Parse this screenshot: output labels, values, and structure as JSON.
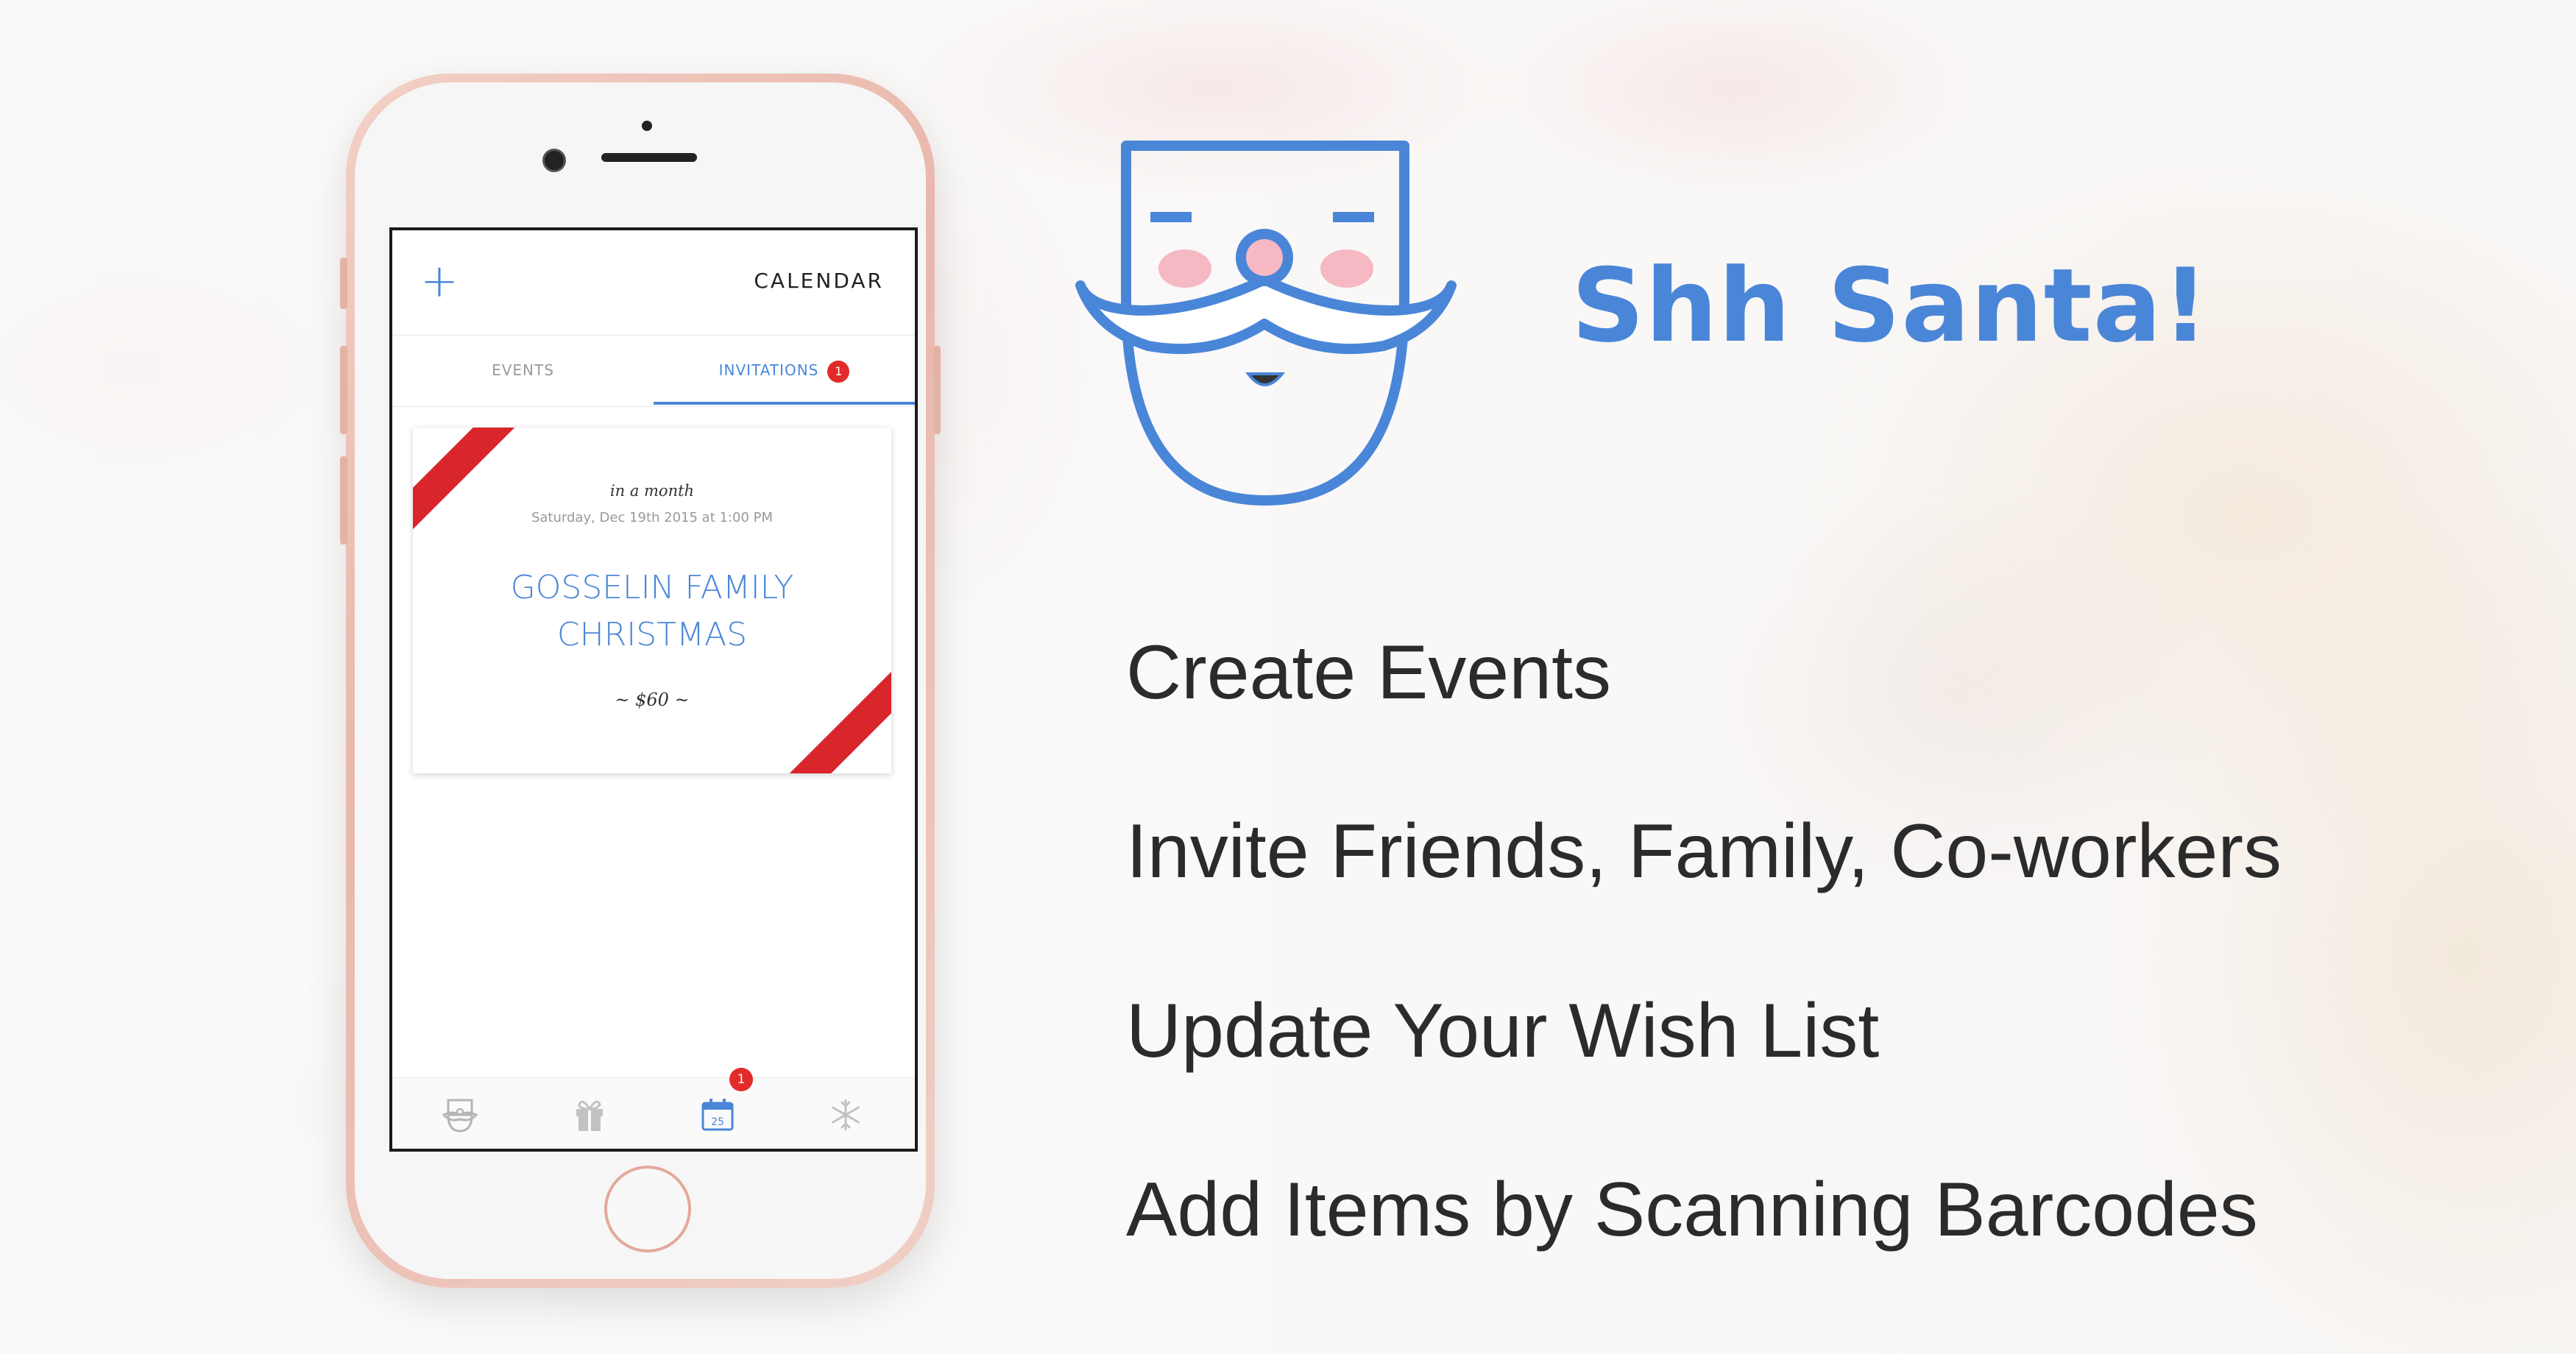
{
  "app": {
    "name": "Shh Santa!",
    "logo_icon": "santa-face-icon",
    "accent_color": "#4a86d8",
    "badge_color": "#e32a2a",
    "ribbon_color": "#d9262c"
  },
  "phone": {
    "nav": {
      "title": "CALENDAR",
      "add_icon": "plus-icon"
    },
    "tabs": [
      {
        "label": "EVENTS",
        "active": false
      },
      {
        "label": "INVITATIONS",
        "active": true,
        "badge": "1"
      }
    ],
    "invitation_card": {
      "relative_time": "in a month",
      "date": "Saturday, Dec 19th 2015 at 1:00 PM",
      "title_line1": "GOSSELIN FAMILY",
      "title_line2": "CHRISTMAS",
      "price": "~ $60 ~"
    },
    "tabbar": {
      "items": [
        {
          "icon": "santa-icon",
          "active": false
        },
        {
          "icon": "gift-icon",
          "active": false
        },
        {
          "icon": "calendar-icon",
          "active": true,
          "badge": "1",
          "day": "25"
        },
        {
          "icon": "snowflake-icon",
          "active": false
        }
      ]
    }
  },
  "features": [
    "Create Events",
    "Invite Friends, Family, Co-workers",
    "Update Your Wish List",
    "Add Items by Scanning Barcodes"
  ]
}
